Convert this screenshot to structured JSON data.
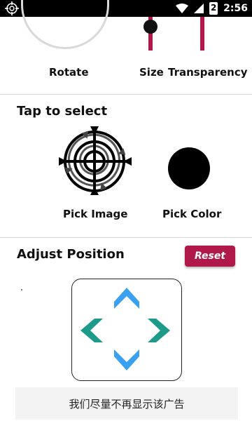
{
  "status_bar": {
    "time": "2:56",
    "battery_level": "2",
    "icons": [
      "crosshair-icon",
      "wifi-icon",
      "cellular-signal-icon",
      "battery-icon"
    ]
  },
  "controls": {
    "rotate_label": "Rotate",
    "size_label": "Size",
    "transparency_label": "Transparency",
    "accent_color": "#b0194a"
  },
  "select": {
    "title": "Tap to select",
    "pick_image_label": "Pick Image",
    "pick_color_label": "Pick Color",
    "current_color": "#000000"
  },
  "position": {
    "title": "Adjust Position",
    "reset_label": "Reset",
    "up_arrow_color": "#3aa0f0",
    "side_arrow_color": "#1e9a8a"
  },
  "ad": {
    "text": "我们尽量不再显示该广告"
  }
}
